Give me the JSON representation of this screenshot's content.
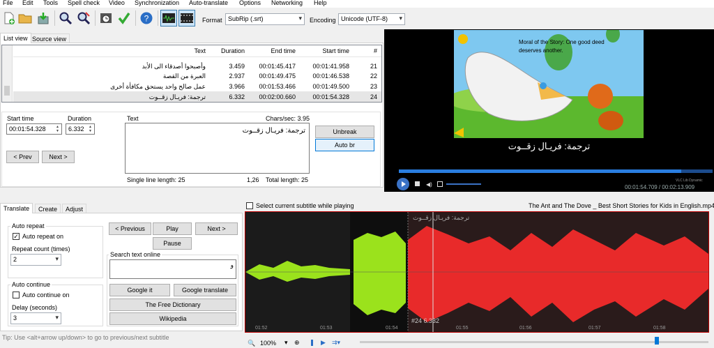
{
  "menu": [
    "File",
    "Edit",
    "Tools",
    "Spell check",
    "Video",
    "Synchronization",
    "Auto-translate",
    "Options",
    "Networking",
    "Help"
  ],
  "toolbar": {
    "format_label": "Format",
    "format_value": "SubRip (.srt)",
    "encoding_label": "Encoding",
    "encoding_value": "Unicode (UTF-8)"
  },
  "tabs": {
    "list_view": "List view",
    "source_view": "Source view"
  },
  "grid": {
    "headers": {
      "num": "#",
      "start": "Start time",
      "end": "End time",
      "duration": "Duration",
      "text": "Text"
    },
    "rows": [
      {
        "num": "21",
        "start": "00:01:41.958",
        "end": "00:01:45.417",
        "duration": "3.459",
        "text": "وأصبحوا أصدقاء الى الأبد"
      },
      {
        "num": "22",
        "start": "00:01:46.538",
        "end": "00:01:49.475",
        "duration": "2.937",
        "text": "العبرة من القصة"
      },
      {
        "num": "23",
        "start": "00:01:49.500",
        "end": "00:01:53.466",
        "duration": "3.966",
        "text": "عمل صالح واحد يستحق مكافأة أخرى"
      },
      {
        "num": "24",
        "start": "00:01:54.328",
        "end": "00:02:00.660",
        "duration": "6.332",
        "text": "ترجمة: فريـال زقــوت"
      }
    ]
  },
  "editor": {
    "start_label": "Start time",
    "start_value": "00:01:54.328",
    "duration_label": "Duration",
    "duration_value": "6.332",
    "text_label": "Text",
    "chars_sec": "Chars/sec: 3.95",
    "text_value": "ترجمة: فريـال زقــوت",
    "prev": "< Prev",
    "next": "Next >",
    "unbreak": "Unbreak",
    "auto_br": "Auto br",
    "single_line": "Single line length: 25",
    "pos": "1,26",
    "total_length": "Total length: 25"
  },
  "video": {
    "subtitle": "ترجمة: فريـال زقــوت",
    "bubble": "Moral of the Story: One good deed deserves another.",
    "brand": "VLC Lib Dynamic",
    "time": "00:01:54.709 / 00:02:13.909"
  },
  "bottom_tabs": {
    "translate": "Translate",
    "create": "Create",
    "adjust": "Adjust"
  },
  "translate": {
    "auto_repeat": "Auto repeat",
    "auto_repeat_on": "Auto repeat on",
    "repeat_count": "Repeat count (times)",
    "repeat_value": "2",
    "auto_continue": "Auto continue",
    "auto_continue_on": "Auto continue on",
    "delay": "Delay (seconds)",
    "delay_value": "3",
    "previous": "< Previous",
    "play": "Play",
    "next": "Next >",
    "pause": "Pause",
    "search_online": "Search text online",
    "search_value": "و",
    "google_it": "Google it",
    "google_translate": "Google translate",
    "free_dict": "The Free Dictionary",
    "wikipedia": "Wikipedia",
    "tip": "Tip: Use <alt+arrow up/down> to go to previous/next subtitle"
  },
  "waveform": {
    "select_current": "Select current subtitle while playing",
    "filename": "The Ant and The Dove _ Best Short Stories for Kids in English.mp4",
    "sub_text": "ترجمة: فريـال زقــوت",
    "label": "#24  6.332",
    "ticks": [
      "01:52",
      "01:53",
      "01:54",
      "01:55",
      "01:56",
      "01:57",
      "01:58"
    ],
    "zoom": "100%"
  },
  "colors": {
    "accent": "#0078d7",
    "wave_green": "#9be21c",
    "wave_red": "#e82a2a"
  }
}
